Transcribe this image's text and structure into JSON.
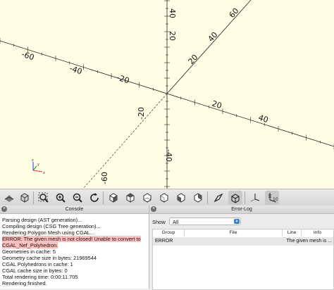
{
  "viewport": {
    "axis_labels": {
      "x_neg": [
        "-60",
        "-40",
        "-20"
      ],
      "x_pos": [
        "20",
        "40"
      ],
      "y_pos": [
        "20",
        "40",
        "60"
      ],
      "z_neg": [
        "-20",
        "-40",
        "-60"
      ],
      "z_pos": [
        "20",
        "40"
      ]
    },
    "axes_indicator": {
      "x": "x",
      "y": "y",
      "z": "z"
    },
    "background_color": "#fffee5"
  },
  "toolbar": {
    "buttons": [
      "preview-icon",
      "render-icon",
      "view-all-icon",
      "zoom-in-icon",
      "zoom-out-icon",
      "reset-view-icon",
      "view-right-icon",
      "view-top-icon",
      "view-bottom-icon",
      "view-left-icon",
      "view-front-icon",
      "view-back-icon",
      "view-diagonal-icon",
      "view-center-icon",
      "perspective-icon",
      "orthogonal-icon",
      "show-axes-icon",
      "show-scale-markers-icon"
    ],
    "scale_marker_text": "10"
  },
  "console": {
    "title": "Console",
    "lines": [
      "Parsing design (AST generation)...",
      "Compiling design (CSG Tree generation)...",
      "Rendering Polygon Mesh using CGAL...",
      "ERROR: The given mesh is not closed! Unable to convert to",
      "CGAL_Nef_Polyhedron.",
      "Geometries in cache: 5",
      "Geometry cache size in bytes: 21969544",
      "CGAL Polyhedrons in cache: 1",
      "CGAL cache size in bytes: 0",
      "Total rendering time: 0:00:11.705",
      "Rendering finished."
    ],
    "error_highlight_color": "#ffc0c0"
  },
  "error_log": {
    "title": "Error-Log",
    "show_label": "Show",
    "show_value": "All",
    "columns": [
      "Group",
      "File",
      "Line",
      "Info"
    ],
    "rows": [
      {
        "group": "ERROR",
        "file": "",
        "line": "",
        "info": "The given mesh is ..."
      }
    ]
  },
  "close_glyph": "×"
}
